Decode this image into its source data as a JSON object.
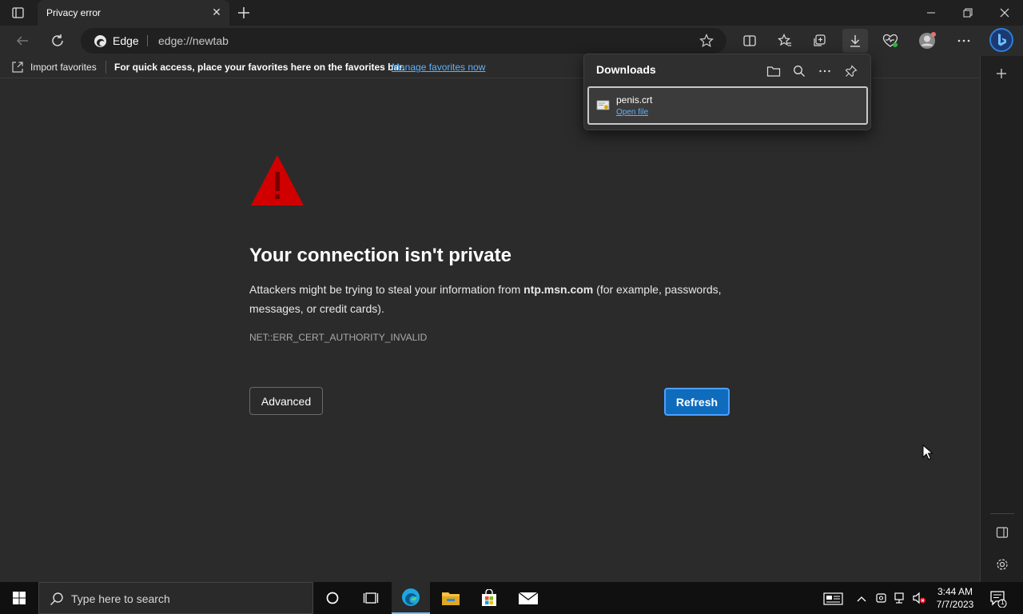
{
  "tab": {
    "title": "Privacy error",
    "close_glyph": "✕"
  },
  "window": {
    "minimize": "—",
    "restore": "❐",
    "close": "✕"
  },
  "address": {
    "brand": "Edge",
    "url": "edge://newtab"
  },
  "favorites_bar": {
    "import_label": "Import favorites",
    "hint": "For quick access, place your favorites here on the favorites bar.",
    "manage_link": "Manage favorites now"
  },
  "error": {
    "title": "Your connection isn't private",
    "desc_before": "Attackers might be trying to steal your information from ",
    "desc_host": "ntp.msn.com",
    "desc_after": " (for example, passwords, messages, or credit cards).",
    "code": "NET::ERR_CERT_AUTHORITY_INVALID",
    "advanced_label": "Advanced",
    "refresh_label": "Refresh"
  },
  "downloads": {
    "title": "Downloads",
    "file_name": "penis.crt",
    "open_label": "Open file"
  },
  "taskbar": {
    "search_placeholder": "Type here to search",
    "time": "3:44 AM",
    "date": "7/7/2023",
    "notification_count": "1"
  },
  "colors": {
    "accent": "#0f6cbd",
    "warning_red": "#d00000",
    "link": "#5cb3ff"
  }
}
